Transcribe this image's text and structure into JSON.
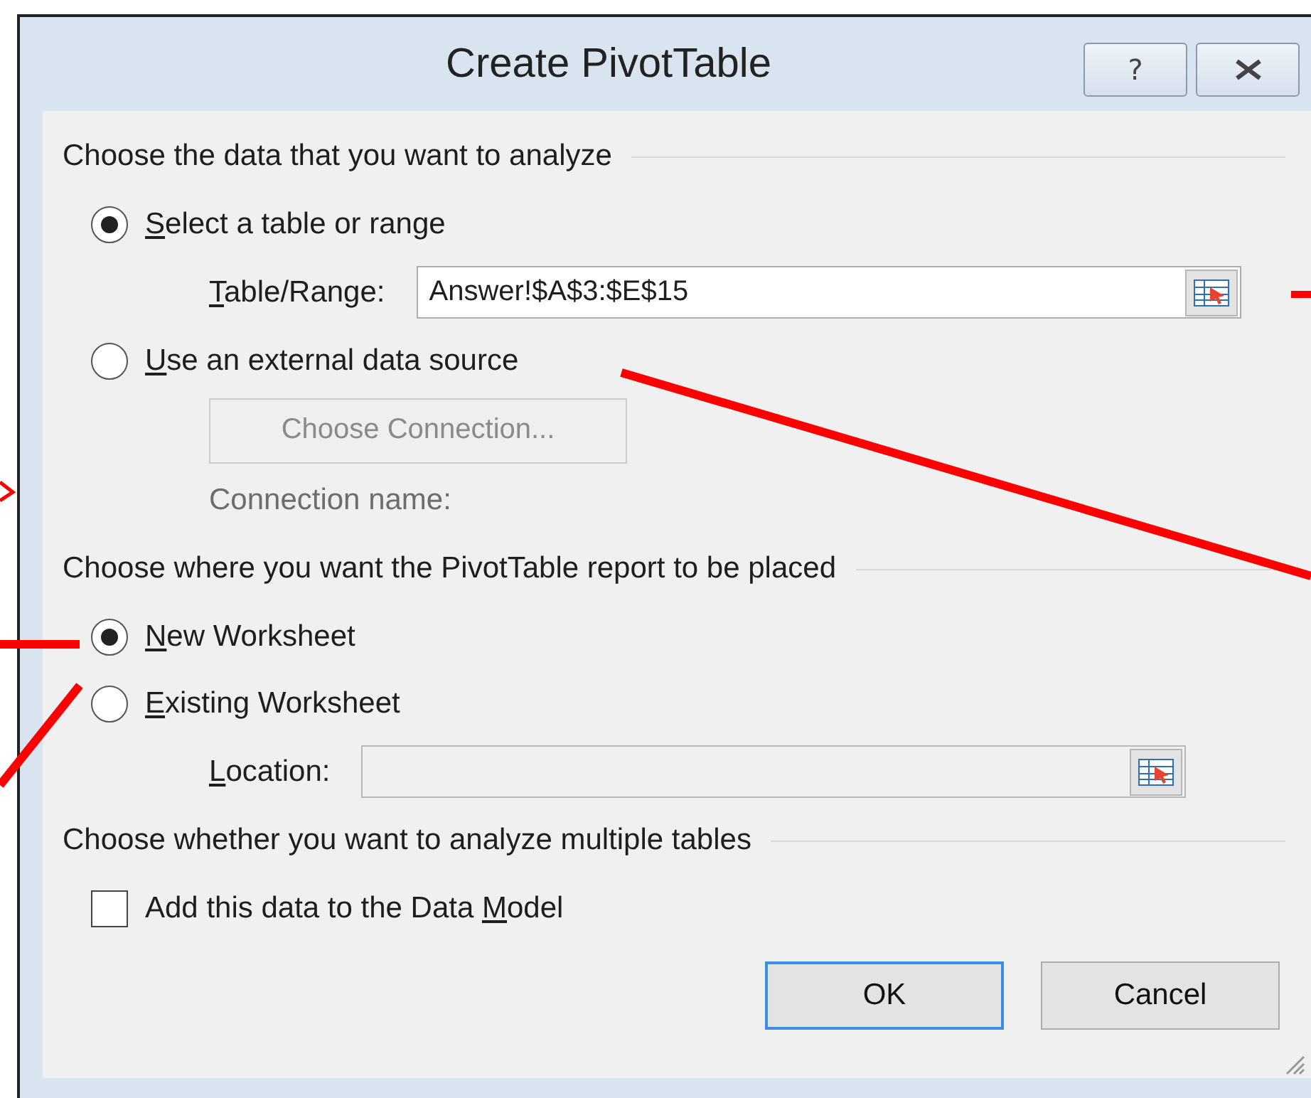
{
  "window": {
    "title": "Create PivotTable",
    "help_label": "?"
  },
  "sections": [
    {
      "heading": "Choose the data that you want to analyze",
      "items": [
        {
          "kind": "radio",
          "label": {
            "key": "S",
            "rest": "elect a table or range"
          },
          "selected": true
        },
        {
          "kind": "field",
          "label": {
            "key": "T",
            "rest": "able/Range:"
          },
          "value": "Answer!$A$3:$E$15",
          "disabled": false
        },
        {
          "kind": "radio",
          "label": {
            "key": "U",
            "rest": "se an external data source"
          },
          "selected": false
        },
        {
          "kind": "button",
          "text": "Choose Connection...",
          "disabled": true
        },
        {
          "kind": "text",
          "text": "Connection name:",
          "disabled": true
        }
      ]
    },
    {
      "heading": "Choose where you want the PivotTable report to be placed",
      "items": [
        {
          "kind": "radio",
          "label": {
            "key": "N",
            "rest": "ew Worksheet"
          },
          "selected": true
        },
        {
          "kind": "radio",
          "label": {
            "key": "E",
            "rest": "xisting Worksheet"
          },
          "selected": false
        },
        {
          "kind": "field",
          "label": {
            "key": "L",
            "rest": "ocation:"
          },
          "disabled": true
        }
      ]
    },
    {
      "heading": "Choose whether you want to analyze multiple tables",
      "items": [
        {
          "kind": "checkbox",
          "label": {
            "pre": "Add this data to the Data ",
            "key": "M",
            "rest": "odel"
          },
          "checked": false
        }
      ]
    }
  ],
  "buttons": [
    {
      "label": "OK",
      "default": true
    },
    {
      "label": "Cancel",
      "default": false
    }
  ]
}
